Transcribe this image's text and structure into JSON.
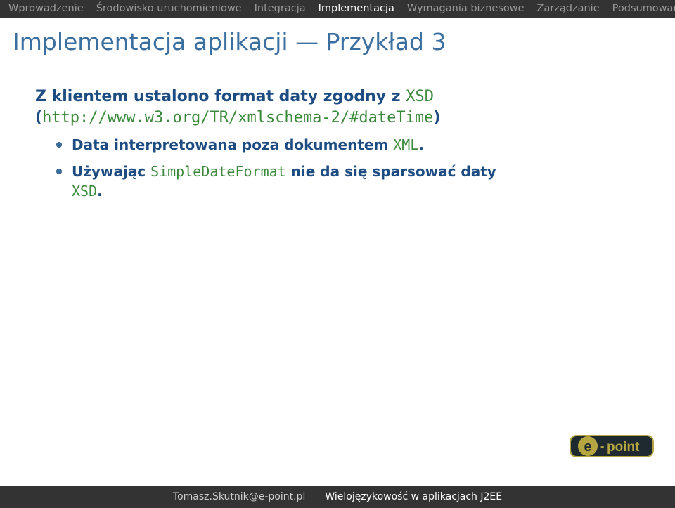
{
  "nav": {
    "items": [
      {
        "label": "Wprowadzenie",
        "active": false
      },
      {
        "label": "Środowisko uruchomieniowe",
        "active": false
      },
      {
        "label": "Integracja",
        "active": false
      },
      {
        "label": "Implementacja",
        "active": true
      },
      {
        "label": "Wymagania biznesowe",
        "active": false
      },
      {
        "label": "Zarządzanie",
        "active": false
      },
      {
        "label": "Podsumowanie",
        "active": false
      }
    ]
  },
  "title": "Implementacja aplikacji — Przykład 3",
  "content": {
    "lead_pre": "Z klientem ustalono format daty zgodny z ",
    "lead_code": "XSD",
    "lparen": "(",
    "url": "http://www.w3.org/TR/xmlschema-2/#dateTime",
    "rparen": ")",
    "bullets": [
      {
        "pre": "Data interpretowana poza dokumentem ",
        "code": "XML",
        "post": "."
      },
      {
        "pre": "Używając ",
        "code": "SimpleDateFormat",
        "post": " nie da się sparsować daty ",
        "code2": "XSD",
        "post2": "."
      }
    ]
  },
  "footer": {
    "author": "Tomasz.Skutnik@e-point.pl",
    "talk": "Wielojęzykowość w aplikacjach J2EE"
  },
  "logo": {
    "prefix": "e",
    "dash": "-",
    "word": "point"
  }
}
